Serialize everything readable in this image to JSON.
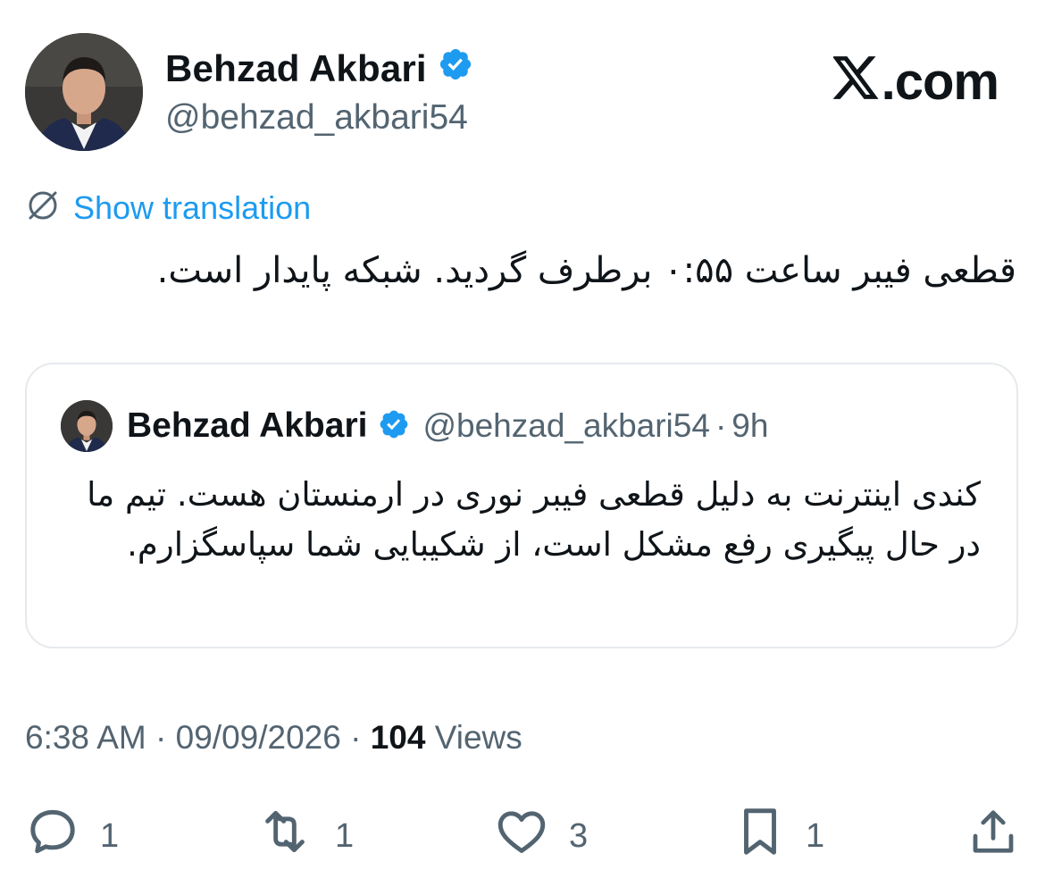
{
  "author": {
    "name": "Behzad Akbari",
    "handle": "@behzad_akbari54",
    "verified": true
  },
  "site_label": ".com",
  "translation_label": "Show translation",
  "tweet_text": "قطعی فیبر ساعت ۰:۵۵ برطرف گردید. شبکه پایدار است.",
  "quoted": {
    "name": "Behzad Akbari",
    "handle": "@behzad_akbari54",
    "separator": "·",
    "time": "9h",
    "text": "کندی اینترنت به دلیل قطعی فیبر نوری در ارمنستان هست. تیم ما در حال پیگیری رفع مشکل است، از شکیبایی شما سپاسگزارم."
  },
  "meta": {
    "time": "6:38 AM",
    "separator": "·",
    "date": "09/09/2026",
    "views_count": "104",
    "views_label": "Views"
  },
  "actions": {
    "replies": "1",
    "reposts": "1",
    "likes": "3",
    "bookmarks": "1"
  },
  "colors": {
    "accent": "#1d9bf0",
    "muted": "#536471",
    "text": "#0f1419",
    "border": "#e6e9ec"
  },
  "icons": [
    "verified-badge-icon",
    "x-logo-icon",
    "translate-globe-icon",
    "reply-icon",
    "repost-icon",
    "like-icon",
    "bookmark-icon",
    "share-icon"
  ]
}
